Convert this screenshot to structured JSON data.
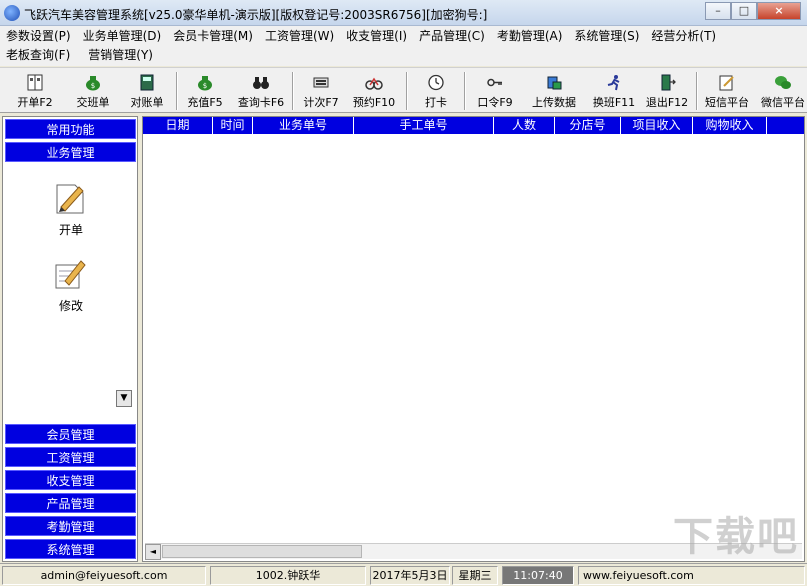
{
  "window": {
    "title": "飞跃汽车美容管理系统[v25.0豪华单机-演示版][版权登记号:2003SR6756][加密狗号:]",
    "minimize_label": "0",
    "restore_label": "□",
    "close_label": "×"
  },
  "menu": {
    "row1": [
      "参数设置(P)",
      "业务单管理(D)",
      "会员卡管理(M)",
      "工资管理(W)",
      "收支管理(I)",
      "产品管理(C)",
      "考勤管理(A)",
      "系统管理(S)",
      "经营分析(T)"
    ],
    "row2": [
      "老板查询(F)",
      "营销管理(Y)"
    ]
  },
  "toolbar": [
    {
      "label": "开单F2",
      "icon": "open-order-icon"
    },
    {
      "label": "交班单",
      "icon": "money-bag-icon"
    },
    {
      "label": "对账单",
      "icon": "ledger-icon"
    },
    {
      "label": "充值F5",
      "icon": "money-bag-icon"
    },
    {
      "label": "查询卡F6",
      "icon": "binoculars-icon"
    },
    {
      "label": "计次F7",
      "icon": "counter-icon"
    },
    {
      "label": "预约F10",
      "icon": "bicycle-icon"
    },
    {
      "label": "打卡",
      "icon": "clock-icon"
    },
    {
      "label": "口令F9",
      "icon": "key-icon"
    },
    {
      "label": "上传数据",
      "icon": "upload-icon"
    },
    {
      "label": "换班F11",
      "icon": "runner-icon"
    },
    {
      "label": "退出F12",
      "icon": "exit-door-icon"
    },
    {
      "label": "短信平台",
      "icon": "sms-icon"
    },
    {
      "label": "微信平台",
      "icon": "wechat-icon"
    }
  ],
  "sidebar": {
    "top": [
      "常用功能",
      "业务管理"
    ],
    "items": [
      {
        "label": "开单",
        "icon": "open-order-icon"
      },
      {
        "label": "修改",
        "icon": "edit-icon"
      }
    ],
    "dropdown_glyph": "▼",
    "bottom": [
      "会员管理",
      "工资管理",
      "收支管理",
      "产品管理",
      "考勤管理",
      "系统管理"
    ]
  },
  "grid": {
    "columns": [
      "日期",
      "时间",
      "业务单号",
      "手工单号",
      "人数",
      "分店号",
      "项目收入",
      "购物收入"
    ],
    "scroll_left_glyph": "◄"
  },
  "statusbar": {
    "email": "admin@feiyuesoft.com",
    "user": "1002.钟跃华",
    "date": "2017年5月3日",
    "weekday": "星期三",
    "time": "11:07:40",
    "website": "www.feiyuesoft.com"
  },
  "watermark": "下载吧",
  "colors": {
    "nav_blue": "#0000e0",
    "grid_header": "#0000e0"
  }
}
